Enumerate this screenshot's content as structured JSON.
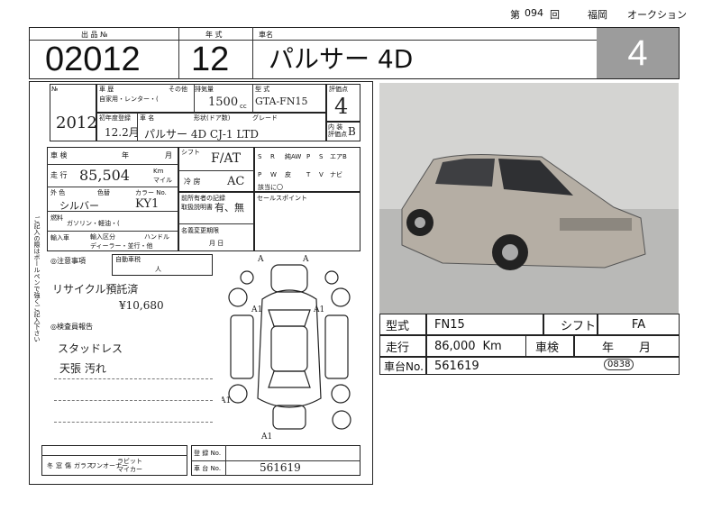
{
  "header": {
    "sale_prefix": "第",
    "sale_number": "094",
    "sale_suffix": "回",
    "location": "福岡",
    "auction": "オークション"
  },
  "top": {
    "lot_label": "出 品 №",
    "lot_number": "02012",
    "year_label": "年 式",
    "year": "12",
    "name_label": "車名",
    "car_name": "パルサー 4D",
    "grade_score": "4"
  },
  "sheet": {
    "corner_label": "№",
    "hand_number": "2012",
    "use_label": "車 歴",
    "use_options": "自家用・レンター・(",
    "other_label": "その他",
    "displacement_label": "排気量",
    "displacement": "1500",
    "cc": "cc",
    "model_label": "型 式",
    "model_hand": "GTA-FN15",
    "eval_label": "評価点",
    "eval_hand": "4",
    "first_reg_label": "初年度登録",
    "first_reg_hand": "12.2月",
    "carname_label": "車 名",
    "doors_label": "形状(ドア数)",
    "grade_label": "グレード",
    "carname_hand": "パルサー 4D CJ-1 LTD",
    "interior_label": "内 装",
    "interior_sub": "評価点",
    "interior_hand": "B",
    "inspection_label": "車 検",
    "inspection_unit_year": "年",
    "inspection_unit_month": "月",
    "mileage_label": "走 行",
    "mileage_hand": "85,504",
    "km_unit": "Km",
    "mile_unit": "マイル",
    "color_label": "外 色",
    "color_original_label": "色替",
    "color_code_label": "カラー No.",
    "color_hand": "シルバー",
    "color_code_hand": "KY1",
    "fuel_label": "燃料",
    "fuel_options": "ガソリン・軽油・(",
    "fuel_hand": "ガソリン",
    "import_label": "輸入車",
    "import_sub": "輸入区分",
    "handle_label": "ハンドル",
    "import_options": "ディーラー・並行・他",
    "shift_label": "シフト",
    "shift_hand": "F/AT",
    "aircon_label": "冷 房",
    "aircon_hand": "AC",
    "equip": [
      "S",
      "R",
      "純AW",
      "P",
      "S",
      "エアB",
      "P",
      "W",
      "皮",
      "T",
      "V",
      "ナビ"
    ],
    "equip_note": "該当に〇",
    "recall_label": "前所有者の記録",
    "recall_hand": "有、無",
    "manual_label": "取扱説明書",
    "warranty_label": "名義変更期限",
    "warranty_unit": "月 日",
    "sales_point_label": "セールスポイント",
    "notes_label": "◎注意事項",
    "recycle_label": "自動車税",
    "recycle_person": "人",
    "notes_hand_1": "リサイクル預託済",
    "notes_hand_2": "¥10,680",
    "inspector_label": "◎検査員報告",
    "inspector_hand_1": "スタッドレス",
    "inspector_hand_2": "天張 汚れ",
    "side_note": "ご記入の際はボールペンで強くご記入下さい",
    "bottom_labels": [
      "冬",
      "窓",
      "傷",
      "ガラス",
      "ワンオーナー",
      "ラビット",
      "マイカー"
    ],
    "reg_label": "登 録 No.",
    "chassis_label": "車 台 No.",
    "chassis_hand": "561619",
    "damage_marks": [
      "A",
      "A",
      "A1",
      "A1",
      "A1",
      "A1"
    ]
  },
  "info": {
    "model_label": "型式",
    "model_value": "FN15",
    "shift_label": "シフト",
    "shift_value": "FA",
    "mileage_label": "走行",
    "mileage_value": "86,000",
    "mileage_unit": "Km",
    "inspection_label": "車検",
    "inspection_year": "年",
    "inspection_month": "月",
    "chassis_label": "車台No.",
    "chassis_value": "561619",
    "stamp_value": "0838"
  },
  "colors": {
    "grade_bg": "#9c9c9c",
    "photo_bg": "#c8c8c6",
    "car_body": "#b5aea4"
  }
}
